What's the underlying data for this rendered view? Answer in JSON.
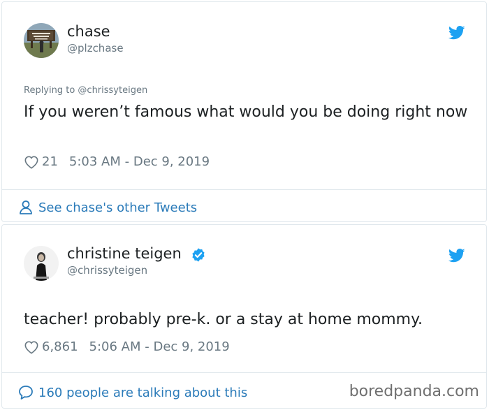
{
  "tweets": [
    {
      "name": "chase",
      "handle": "@plzchase",
      "replying_to": "Replying to @chrissyteigen",
      "text": "If you weren’t famous what would you be doing right now",
      "likes": "21",
      "timestamp": "5:03 AM - Dec 9, 2019",
      "footer": "See chase's other Tweets",
      "avatar_icon": "road-sign-photo",
      "verified": false
    },
    {
      "name": "christine teigen",
      "handle": "@chrissyteigen",
      "text": "teacher! probably pre-k. or a stay at home mommy.",
      "likes": "6,861",
      "timestamp": "5:06 AM - Dec 9, 2019",
      "footer": "160 people are talking about this",
      "avatar_icon": "portrait-photo",
      "verified": true
    }
  ],
  "watermark": "boredpanda.com",
  "colors": {
    "link": "#2b7bb9",
    "twitter_blue": "#1da1f2",
    "secondary_text": "#697882",
    "border": "#e1e8ed"
  }
}
